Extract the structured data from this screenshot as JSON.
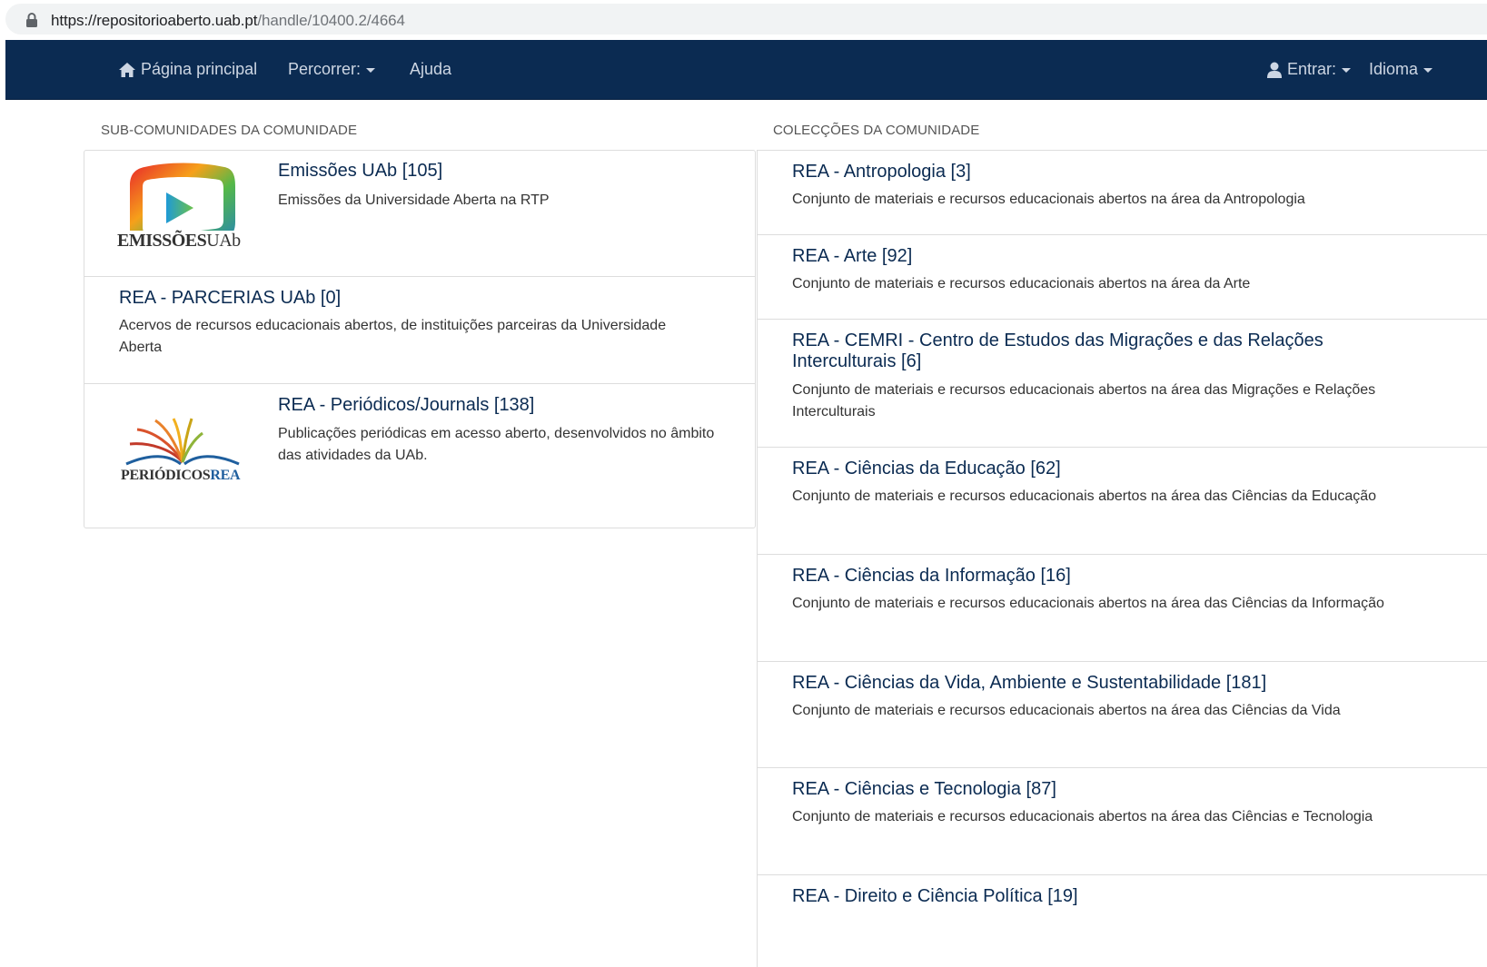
{
  "browser": {
    "url_host": "https://repositorioaberto.uab.pt",
    "url_path": "/handle/10400.2/4664"
  },
  "navbar": {
    "home": "Página principal",
    "browse": "Percorrer:",
    "help": "Ajuda",
    "login": "Entrar:",
    "language": "Idioma"
  },
  "subcommunities": {
    "heading": "SUB-COMUNIDADES DA COMUNIDADE",
    "items": [
      {
        "title": "Emissões UAb [105]",
        "desc": "Emissões da Universidade Aberta na RTP",
        "logo_text_a": "EMISSÕES",
        "logo_text_b": "UAb"
      },
      {
        "title": "REA - PARCERIAS UAb [0]",
        "desc": "Acervos de recursos educacionais abertos, de instituições parceiras da Universidade Aberta"
      },
      {
        "title": "REA - Periódicos/Journals [138]",
        "desc": "Publicações periódicas em acesso aberto, desenvolvidos no âmbito das atividades da UAb.",
        "logo_text_a": "PERIÓDICOS",
        "logo_text_b": "REA"
      }
    ]
  },
  "collections": {
    "heading": "COLECÇÕES DA COMUNIDADE",
    "items": [
      {
        "title": "REA - Antropologia [3]",
        "desc": "Conjunto de materiais e recursos educacionais abertos na área da Antropologia"
      },
      {
        "title": "REA - Arte [92]",
        "desc": "Conjunto de materiais e recursos educacionais abertos na área da Arte"
      },
      {
        "title": "REA - CEMRI - Centro de Estudos das Migrações e das Relações Interculturais [6]",
        "desc": "Conjunto de materiais e recursos educacionais abertos na área das Migrações e Relações Interculturais"
      },
      {
        "title": "REA - Ciências da Educação [62]",
        "desc": "Conjunto de materiais e recursos educacionais abertos na área das Ciências da Educação"
      },
      {
        "title": "REA - Ciências da Informação [16]",
        "desc": "Conjunto de materiais e recursos educacionais abertos na área das Ciências da Informação"
      },
      {
        "title": "REA - Ciências da Vida, Ambiente e Sustentabilidade [181]",
        "desc": "Conjunto de materiais e recursos educacionais abertos na área das Ciências da Vida"
      },
      {
        "title": "REA - Ciências e Tecnologia [87]",
        "desc": "Conjunto de materiais e recursos educacionais abertos na área das Ciências e Tecnologia"
      },
      {
        "title": "REA - Direito e Ciência Política [19]",
        "desc": ""
      }
    ]
  },
  "colors": {
    "navbar_bg": "#0b2b52",
    "link": "#0b2b52",
    "border": "#dddddd"
  },
  "icons": {
    "lock": "lock-icon",
    "home": "home-icon",
    "user": "user-icon",
    "caret": "caret-down-icon"
  }
}
